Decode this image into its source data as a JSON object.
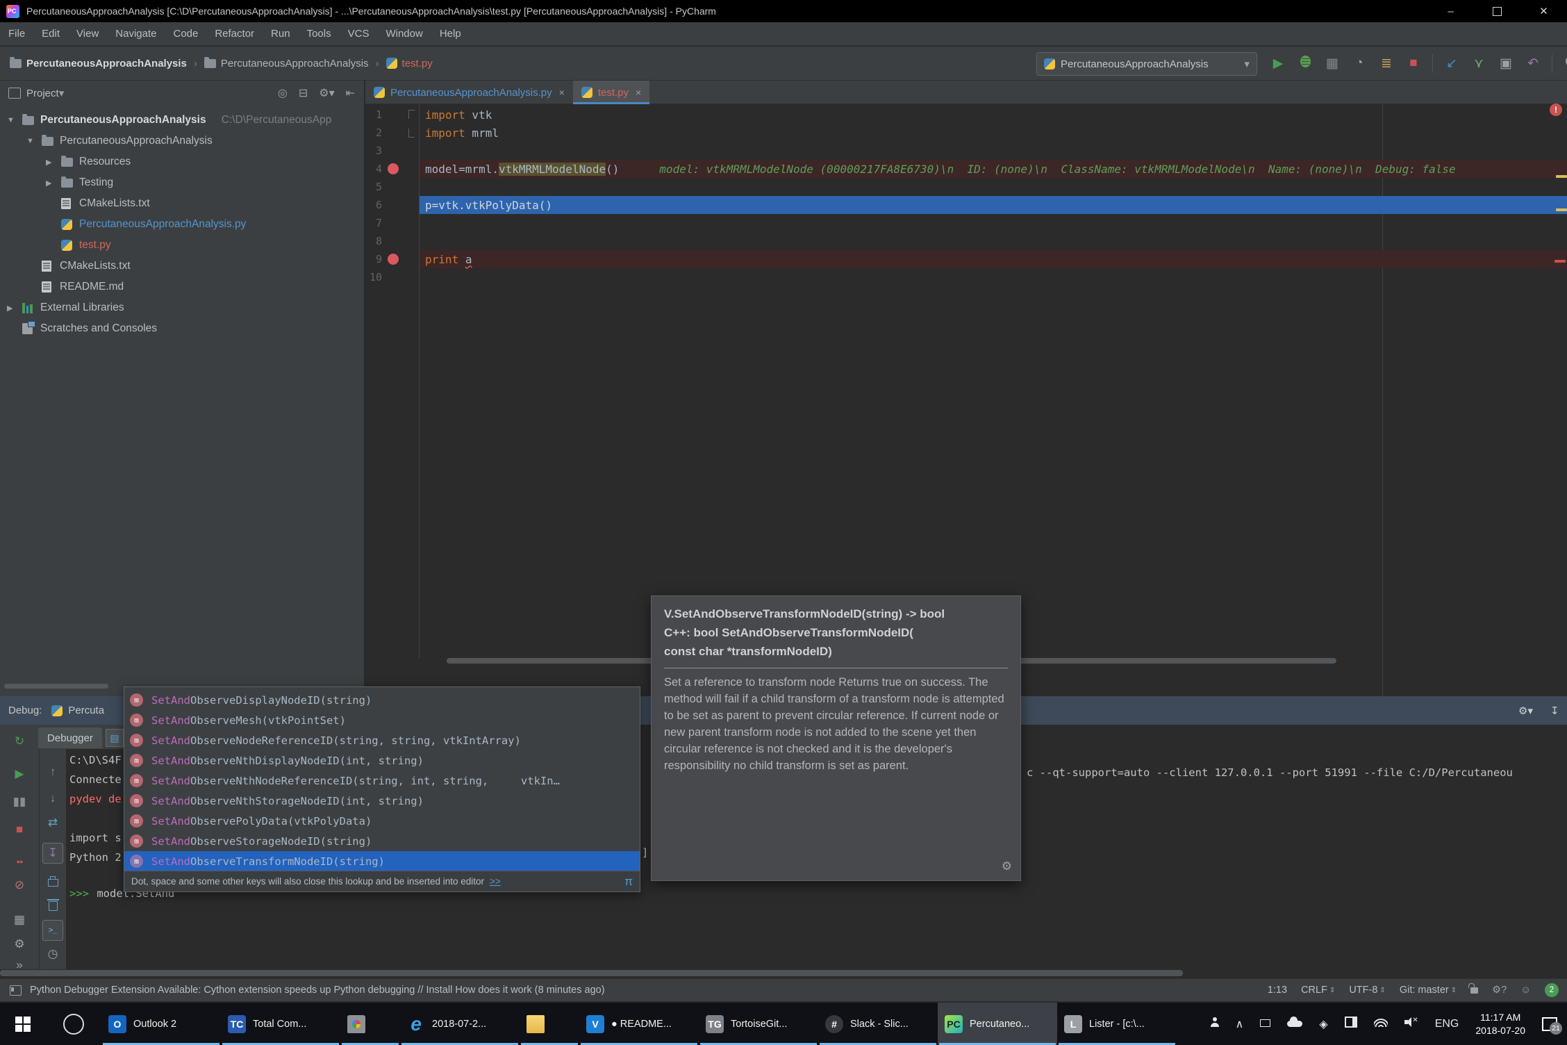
{
  "window": {
    "title": "PercutaneousApproachAnalysis [C:\\D\\PercutaneousApproachAnalysis] - ...\\PercutaneousApproachAnalysis\\test.py [PercutaneousApproachAnalysis] - PyCharm",
    "controls": {
      "minimize": "–",
      "maximize": "",
      "close": "✕"
    }
  },
  "menu": {
    "items": [
      "File",
      "Edit",
      "View",
      "Navigate",
      "Code",
      "Refactor",
      "Run",
      "Tools",
      "VCS",
      "Window",
      "Help"
    ]
  },
  "toolbar": {
    "breadcrumbs": [
      {
        "label": "PercutaneousApproachAnalysis",
        "icon": "folder",
        "bold": true
      },
      {
        "label": "PercutaneousApproachAnalysis",
        "icon": "folder",
        "bold": false
      },
      {
        "label": "test.py",
        "icon": "python",
        "color": "#d1675a"
      }
    ],
    "run_config": {
      "label": "PercutaneousApproachAnalysis",
      "icon": "python"
    },
    "actions": [
      {
        "name": "run",
        "glyph": "▶",
        "color": "#499c54"
      },
      {
        "name": "debug",
        "glyph": "bug",
        "color": "#499c54"
      },
      {
        "name": "run-with-coverage",
        "glyph": "▦",
        "color": "#85888b"
      },
      {
        "name": "profiler",
        "glyph": "◔",
        "color": "#9da0a3"
      },
      {
        "name": "concurrency-diagram",
        "glyph": "≣",
        "color": "#c8a35f"
      },
      {
        "name": "stop",
        "glyph": "■",
        "color": "#c75450"
      },
      {
        "name": "sep"
      },
      {
        "name": "update-project",
        "glyph": "↙",
        "color": "#4a88c7"
      },
      {
        "name": "vcs-commit",
        "glyph": "⋎",
        "color": "#6aab73"
      },
      {
        "name": "recent-changes",
        "glyph": "▣",
        "color": "#9da0a3"
      },
      {
        "name": "rollback",
        "glyph": "↶",
        "color": "#9876aa"
      },
      {
        "name": "sep"
      },
      {
        "name": "search-everywhere",
        "glyph": "mag",
        "color": "#9da0a3"
      }
    ]
  },
  "project_panel": {
    "header": {
      "title": "Project",
      "dropdown": "▾",
      "icons": [
        {
          "name": "locate",
          "glyph": "◎"
        },
        {
          "name": "collapse-all",
          "glyph": "⊟"
        },
        {
          "name": "settings",
          "glyph": "⚙▾"
        },
        {
          "name": "hide",
          "glyph": "⇤"
        }
      ]
    },
    "tree": [
      {
        "indent": 0,
        "arrow": "▼",
        "icon": "folder",
        "label": "PercutaneousApproachAnalysis",
        "bold": true,
        "path": "C:\\D\\PercutaneousApp"
      },
      {
        "indent": 1,
        "arrow": "▼",
        "icon": "folder",
        "label": "PercutaneousApproachAnalysis"
      },
      {
        "indent": 2,
        "arrow": "▶",
        "icon": "folder",
        "label": "Resources"
      },
      {
        "indent": 2,
        "arrow": "▶",
        "icon": "folder",
        "label": "Testing"
      },
      {
        "indent": 2,
        "icon": "file",
        "label": "CMakeLists.txt"
      },
      {
        "indent": 2,
        "icon": "python",
        "label": "PercutaneousApproachAnalysis.py",
        "color": "blue"
      },
      {
        "indent": 2,
        "icon": "python",
        "label": "test.py",
        "color": "red"
      },
      {
        "indent": 1,
        "icon": "file",
        "label": "CMakeLists.txt"
      },
      {
        "indent": 1,
        "icon": "file",
        "label": "README.md"
      },
      {
        "indent": 0,
        "arrow": "▶",
        "icon": "library",
        "label": "External Libraries"
      },
      {
        "indent": 0,
        "icon": "scratches",
        "label": "Scratches and Consoles"
      }
    ]
  },
  "editor": {
    "tabs": [
      {
        "label": "PercutaneousApproachAnalysis.py",
        "color": "#5394cf",
        "active": false,
        "close": "×"
      },
      {
        "label": "test.py",
        "color": "#d1675a",
        "active": true,
        "close": "×"
      }
    ],
    "lines": [
      {
        "n": "1",
        "tokens": [
          {
            "t": "import",
            "c": "kw"
          },
          {
            "t": " vtk",
            "c": "plain"
          }
        ],
        "fold": "top"
      },
      {
        "n": "2",
        "tokens": [
          {
            "t": "import",
            "c": "kw"
          },
          {
            "t": " mrml",
            "c": "plain"
          }
        ],
        "fold": "bot"
      },
      {
        "n": "3",
        "tokens": []
      },
      {
        "n": "4",
        "bg": "bp",
        "breakpoint": true,
        "tokens": [
          {
            "t": "model=mrml.",
            "c": "plain"
          },
          {
            "t": "vtkMRMLModelNode",
            "c": "plain",
            "hl": true
          },
          {
            "t": "()",
            "c": "plain"
          }
        ],
        "inline_debug": "model: vtkMRMLModelNode (00000217FA8E6730)\\n  ID: (none)\\n  ClassName: vtkMRMLModelNode\\n  Name: (none)\\n  Debug: false"
      },
      {
        "n": "5",
        "tokens": []
      },
      {
        "n": "6",
        "bg": "exec",
        "tokens": [
          {
            "t": "p=vtk.vtkPolyData()",
            "c": "exec"
          }
        ]
      },
      {
        "n": "7",
        "tokens": []
      },
      {
        "n": "8",
        "tokens": []
      },
      {
        "n": "9",
        "bg": "bp",
        "breakpoint": true,
        "tokens": [
          {
            "t": "print",
            "c": "kw"
          },
          {
            "t": " ",
            "c": "plain"
          },
          {
            "t": "a",
            "c": "plain",
            "err": true
          }
        ]
      },
      {
        "n": "10",
        "tokens": []
      }
    ],
    "error_indicator": "!"
  },
  "debug_panel": {
    "header": {
      "label": "Debug:",
      "tab": "Percuta",
      "gear": "⚙",
      "dropdown": "▾",
      "hide": "↧"
    },
    "debugger_tab": "Debugger",
    "console_tab_glyph": "▤",
    "left_toolbar": [
      {
        "name": "rerun",
        "glyph": "↻",
        "color": "#499c54"
      },
      {
        "name": "resume",
        "glyph": "▶",
        "color": "#499c54"
      },
      {
        "name": "pause",
        "glyph": "▮▮",
        "color": "#8a8d90"
      },
      {
        "name": "stop",
        "glyph": "■",
        "color": "#c75450"
      },
      {
        "name": "view-breakpoints",
        "glyph": "●●",
        "color": "#c75450"
      },
      {
        "name": "mute-breakpoints",
        "glyph": "⊘",
        "color": "#b3766d"
      },
      {
        "name": "restore-layout",
        "glyph": "▦",
        "color": "#9da0a3"
      },
      {
        "name": "settings",
        "glyph": "⚙",
        "color": "#9da0a3"
      },
      {
        "name": "more",
        "glyph": "»",
        "color": "#9da0a3"
      }
    ],
    "second_toolbar": [
      {
        "name": "step-up",
        "glyph": "↑",
        "color": "#8a8d90"
      },
      {
        "name": "step-down",
        "glyph": "↓",
        "color": "#8a8d90"
      },
      {
        "name": "compare-frames",
        "glyph": "⇄",
        "color": "#63a0c8"
      },
      {
        "name": "scroll-to-end",
        "glyph": "↧",
        "color": "#9876aa",
        "boxed": true
      },
      {
        "name": "print",
        "glyph": "print",
        "color": "#63a0c8"
      },
      {
        "name": "clear-all",
        "glyph": "trash",
        "color": "#63a0c8"
      },
      {
        "name": "show-console",
        "glyph": ">_",
        "color": "#63a0c8",
        "boxed": true
      },
      {
        "name": "browse-history",
        "glyph": "◷",
        "color": "#9da0a3"
      }
    ],
    "console_fragments": [
      {
        "text": "C:\\D\\S4F",
        "role": "plain"
      },
      {
        "text": "Connecte",
        "role": "plain"
      },
      {
        "text": "pydev de",
        "role": "error"
      },
      {
        "text": "import s",
        "role": "plain"
      },
      {
        "text": "Python 2",
        "role": "plain"
      },
      {
        "text": ">>>",
        "role": "prompt"
      },
      {
        "text": " model.SetAnd",
        "role": "plain"
      },
      {
        "text": "c --qt-support=auto --client 127.0.0.1 --port 51991 --file C:/D/Percutaneou",
        "role": "plain"
      },
      {
        "text": "]",
        "role": "plain"
      }
    ]
  },
  "autocomplete": {
    "items": [
      {
        "match": "SetAnd",
        "rest": "ObserveDisplayNodeID(string)"
      },
      {
        "match": "SetAnd",
        "rest": "ObserveMesh(vtkPointSet)"
      },
      {
        "match": "SetAnd",
        "rest": "ObserveNodeReferenceID(string, string, vtkIntArray)"
      },
      {
        "match": "SetAnd",
        "rest": "ObserveNthDisplayNodeID(int, string)"
      },
      {
        "match": "SetAnd",
        "rest": "ObserveNthNodeReferenceID(string, int, string,     vtkIn…"
      },
      {
        "match": "SetAnd",
        "rest": "ObserveNthStorageNodeID(int, string)"
      },
      {
        "match": "SetAnd",
        "rest": "ObservePolyData(vtkPolyData)"
      },
      {
        "match": "SetAnd",
        "rest": "ObserveStorageNodeID(string)"
      },
      {
        "match": "SetAnd",
        "rest": "ObserveTransformNodeID(string)",
        "selected": true
      }
    ],
    "icon_letter": "m",
    "footer": {
      "text": "Dot, space and some other keys will also close this lookup and be inserted into editor",
      "link": ">>",
      "pi": "π"
    },
    "selection_color": "#2362bd"
  },
  "doc_popup": {
    "signature": [
      "V.SetAndObserveTransformNodeID(string) -> bool",
      "C++: bool SetAndObserveTransformNodeID(",
      "const char *transformNodeID)"
    ],
    "body": "Set a reference to transform node Returns true on success. The method will fail if a child transform of a transform node is attempted to be set as parent to prevent circular reference. If current node or new parent transform node is not added to the scene yet then circular reference is not checked and it is the developer's responsibility no child transform is set as parent.",
    "gear": "⚙"
  },
  "status_bar": {
    "message": "Python Debugger Extension Available: Cython extension speeds up Python debugging // Install How does it work (8 minutes ago)",
    "right": [
      {
        "name": "cursor-position",
        "label": "1:13"
      },
      {
        "name": "line-ending",
        "label": "CRLF",
        "chev": "⇕"
      },
      {
        "name": "encoding",
        "label": "UTF-8",
        "chev": "⇕"
      },
      {
        "name": "git-branch",
        "label": "Git: master",
        "chev": "⇕"
      },
      {
        "name": "lock",
        "icon": "lock"
      },
      {
        "name": "inspections-settings",
        "icon": "gear-question",
        "glyph": "⚙?"
      },
      {
        "name": "hector",
        "icon": "face",
        "glyph": "☺"
      },
      {
        "name": "notifications",
        "badge": "2"
      }
    ]
  },
  "taskbar": {
    "items": [
      {
        "name": "outlook",
        "label": "Outlook 2",
        "ic": "outlook"
      },
      {
        "name": "total-commander",
        "label": "Total Com...",
        "ic": "totalcmd"
      },
      {
        "name": "chrome-folder",
        "label": "",
        "ic": "chromefolder"
      },
      {
        "name": "edge",
        "label": "2018-07-2...",
        "ic": "edge"
      },
      {
        "name": "explorer",
        "label": "",
        "ic": "folder"
      },
      {
        "name": "vscode",
        "label": "● README...",
        "ic": "vscode"
      },
      {
        "name": "tortoisegit",
        "label": "TortoiseGit...",
        "ic": "tortoise"
      },
      {
        "name": "slack",
        "label": "Slack - Slic...",
        "ic": "slack"
      },
      {
        "name": "pycharm",
        "label": "Percutaneo...",
        "ic": "pycharm",
        "active": true
      },
      {
        "name": "lister",
        "label": "Lister - [c:\\...",
        "ic": "lister"
      }
    ],
    "tray": [
      {
        "name": "people",
        "ic": "person"
      },
      {
        "name": "hidden-icons",
        "glyph": "∧"
      },
      {
        "name": "device",
        "ic": "dev"
      },
      {
        "name": "onedrive",
        "ic": "cloud"
      },
      {
        "name": "dropbox",
        "glyph": "◈"
      },
      {
        "name": "snip",
        "ic": "snip"
      },
      {
        "name": "wifi",
        "ic": "wifi"
      },
      {
        "name": "volume-muted",
        "ic": "mute"
      },
      {
        "name": "language",
        "label": "ENG"
      }
    ],
    "clock": {
      "time": "11:17 AM",
      "date": "2018-07-20"
    },
    "notifications": {
      "count": "21"
    }
  },
  "colors": {
    "execution_line": "#2e64ad",
    "breakpoint_line": "#3c2626",
    "breakpoint_dot": "#db5860",
    "keyword": "#cc7832",
    "inline_debug": "#5f9e5a",
    "tab_underline": "#4a88c7",
    "selection": "#2362bd"
  }
}
